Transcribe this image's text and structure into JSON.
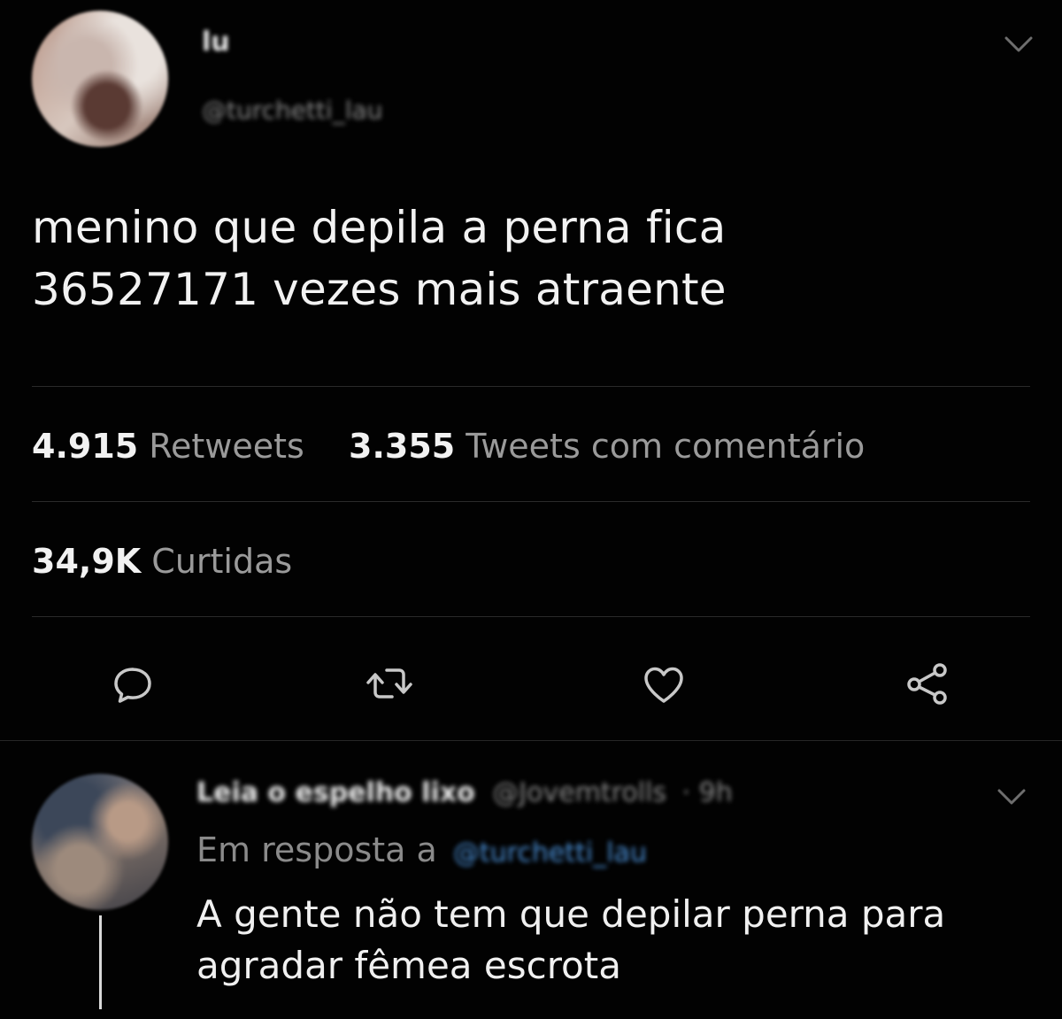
{
  "tweet": {
    "author_name": "lu",
    "author_handle": "@turchetti_lau",
    "text_lines": [
      "menino que depila a perna fica",
      "36527171 vezes mais atraente"
    ],
    "retweets_count": "4.915",
    "retweets_label": "Retweets",
    "quotes_count": "3.355",
    "quotes_label": "Tweets com comentário",
    "likes_count": "34,9K",
    "likes_label": "Curtidas"
  },
  "reply": {
    "author_name": "Leia o espelho lixo",
    "author_handle": "@Jovemtrolls",
    "time": "· 9h",
    "in_reply_label": "Em resposta a",
    "in_reply_mention": "@turchetti_lau",
    "text_lines": [
      "A gente não tem que depilar perna para",
      "agradar fêmea escrota"
    ]
  },
  "icons": {
    "reply": "comment-icon",
    "retweet": "retweet-icon",
    "like": "heart-icon",
    "share": "share-icon",
    "more": "chevron-down-icon"
  },
  "colors": {
    "background": "#020202",
    "text": "#f2f2f2",
    "muted": "#9a9a9a",
    "link": "#4a8fd6"
  }
}
